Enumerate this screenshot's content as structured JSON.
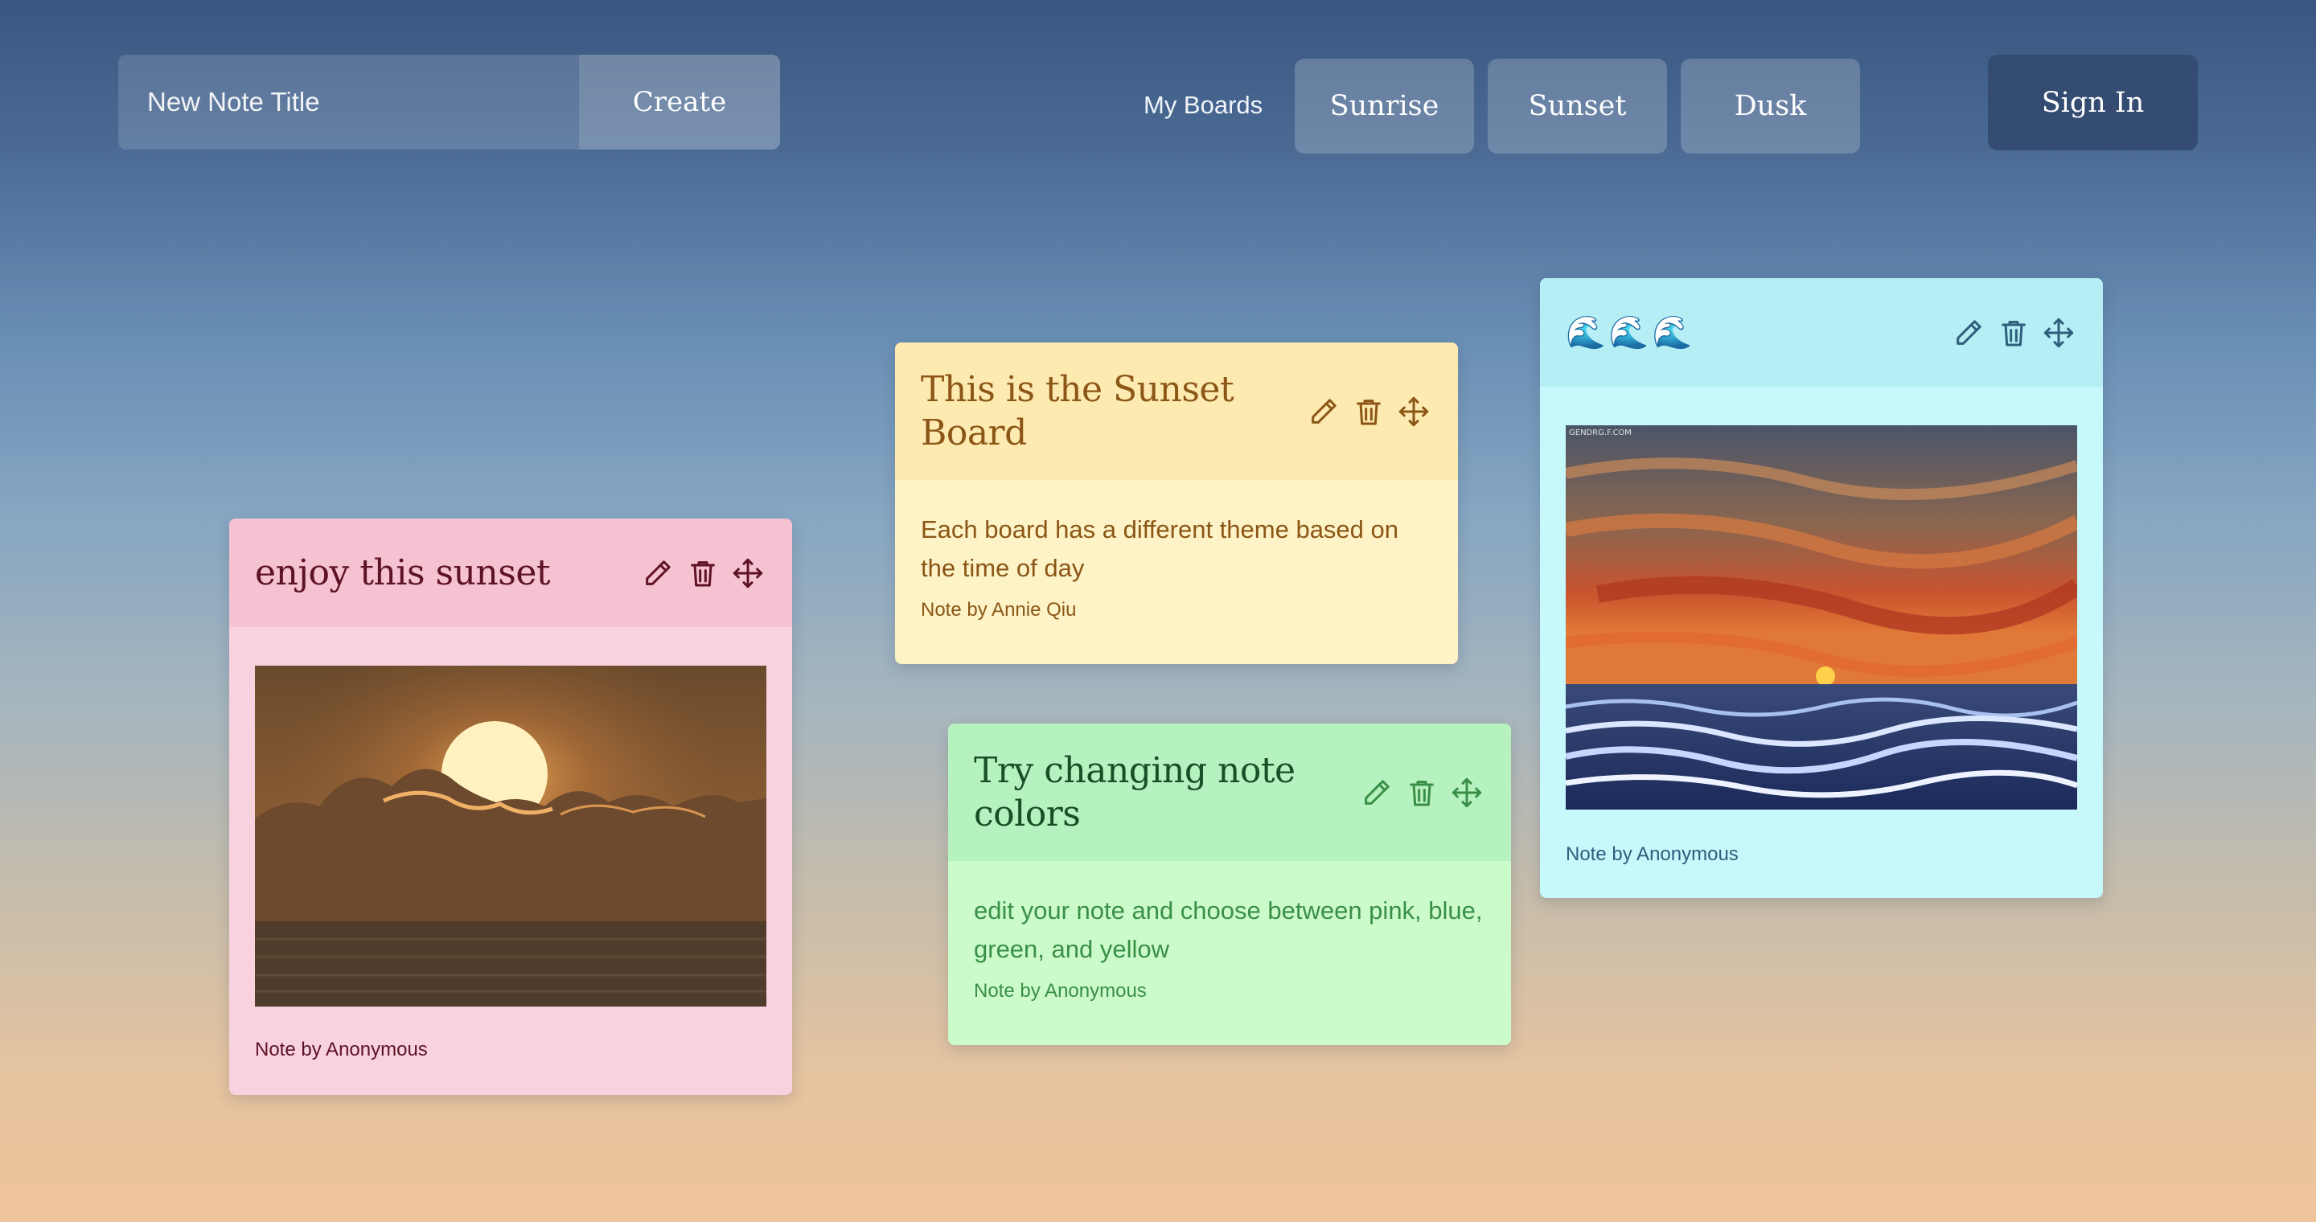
{
  "header": {
    "title_placeholder": "New Note Title",
    "create_label": "Create",
    "boards_label": "My Boards",
    "boards": [
      {
        "label": "Sunrise"
      },
      {
        "label": "Sunset"
      },
      {
        "label": "Dusk"
      }
    ],
    "sign_in_label": "Sign In"
  },
  "notes": [
    {
      "color": "pink",
      "title": "enjoy this sunset",
      "author": "Note by Anonymous",
      "accent": "#f5c2d2"
    },
    {
      "color": "yellow",
      "title": "This is the Sunset Board",
      "text": "Each board has a different theme based on the time of day",
      "author": "Note by Annie Qiu",
      "accent": "#fdeab0"
    },
    {
      "color": "green",
      "title": "Try changing note colors",
      "text": "edit your note and choose between pink, blue, green, and yellow",
      "author": "Note by Anonymous",
      "accent": "#b6f2bf"
    },
    {
      "color": "blue",
      "title": "🌊🌊🌊",
      "image_watermark": "GENDRG.F.COM",
      "author": "Note by Anonymous",
      "accent": "#b5eef5"
    }
  ],
  "icons": {
    "edit": "pencil-icon",
    "delete": "trash-icon",
    "move": "move-arrows-icon"
  }
}
